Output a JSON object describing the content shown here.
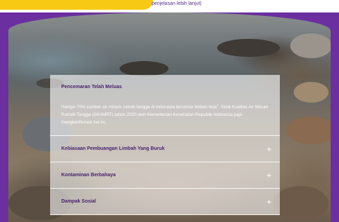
{
  "banner": {
    "text": "penjelasan lebih lanjut)"
  },
  "accordion": {
    "items": [
      {
        "title": "Pencemaran Telah Meluas",
        "open": true,
        "body_part1": "Hampir 70% sumber air minum rumah tangga di Indonesia tercemar limbah tinja",
        "footnote": "1",
        "body_part2": ". Studi Kualitas Air Minum Rumah Tangga (SKAMRT) tahun 2020 oleh Kementerian Kesehatan Republik Indonesia juga mengkonfirmasi hal ini."
      },
      {
        "title": "Kebiasaan Pembuangan Limbah Yang Buruk",
        "open": false,
        "icon": "plus-icon",
        "icon_glyph": "+"
      },
      {
        "title": "Kontaminan Berbahaya",
        "open": false,
        "icon": "plus-icon",
        "icon_glyph": "+"
      },
      {
        "title": "Dampak Sosial",
        "open": false,
        "icon": "plus-icon",
        "icon_glyph": "+"
      }
    ]
  },
  "colors": {
    "brand_purple": "#5a2a8c",
    "accent_yellow": "#f7c914"
  }
}
